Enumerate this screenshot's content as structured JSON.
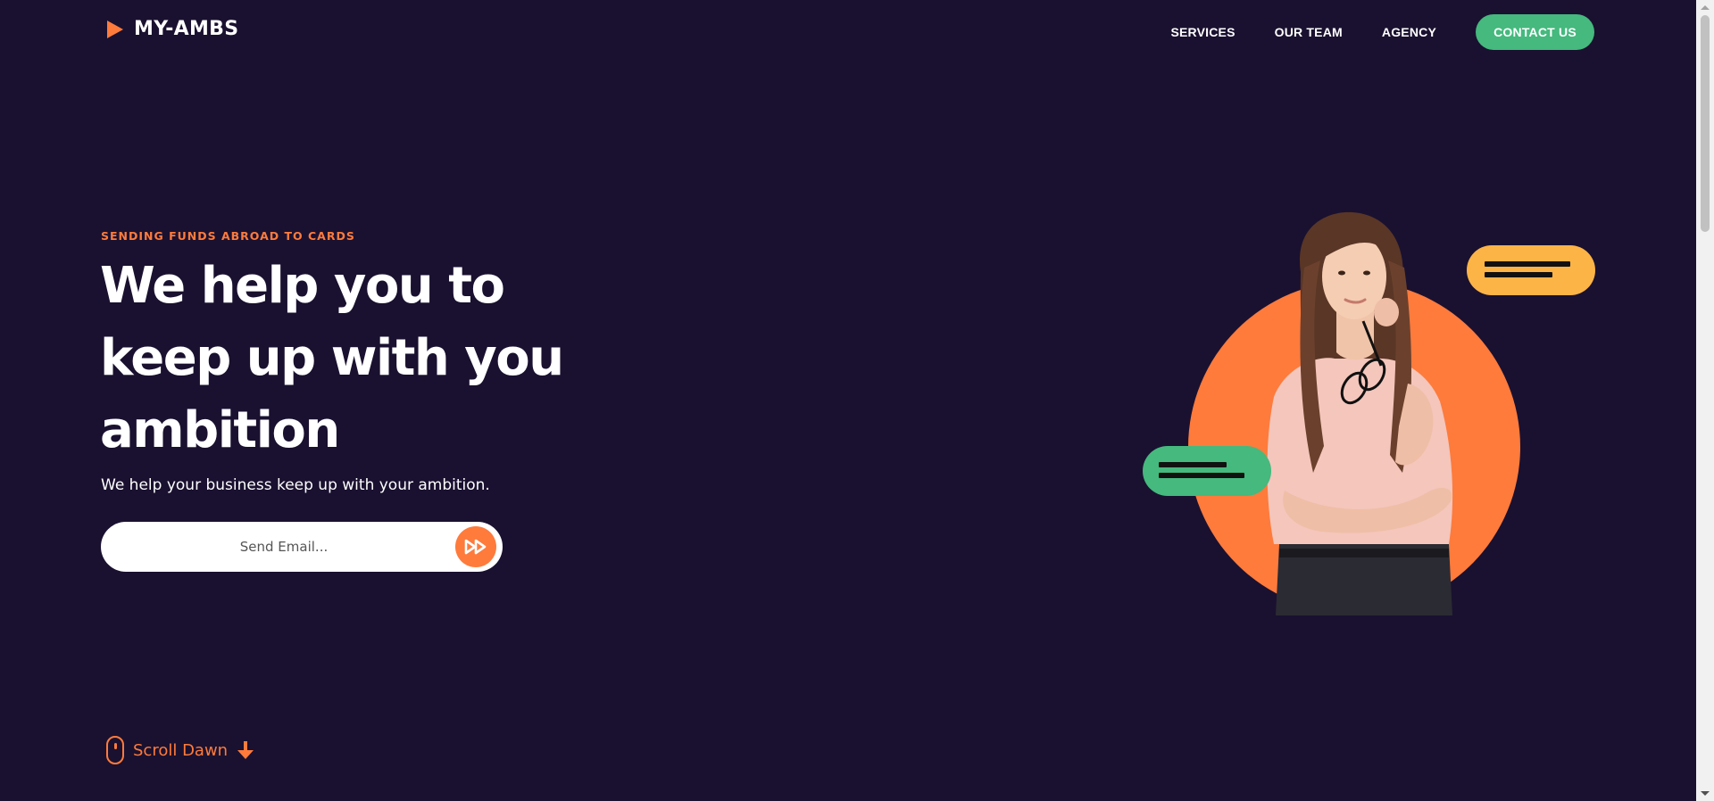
{
  "header": {
    "logo_text": "MY-AMBS",
    "nav": {
      "services": "SERVICES",
      "our_team": "OUR TEAM",
      "agency": "AGENCY",
      "contact": "CONTACT US"
    }
  },
  "hero": {
    "eyebrow": "SENDING FUNDS ABROAD TO CARDS",
    "headline_line1": "We help you to",
    "headline_line2": "keep up with you",
    "headline_line3": "ambition",
    "subtitle": "We help your business keep up with your ambition.",
    "email_placeholder": "Send Email...",
    "scroll_label": "Scroll Dawn"
  },
  "icons": {
    "logo": "play-triangle-icon",
    "send": "fast-forward-icon",
    "scroll": "mouse-icon",
    "scroll_arrow": "arrow-down-icon"
  },
  "colors": {
    "background": "#1a1130",
    "accent_orange": "#fe7b3c",
    "accent_green": "#45b97e",
    "accent_yellow": "#fdb446",
    "text": "#ffffff"
  }
}
